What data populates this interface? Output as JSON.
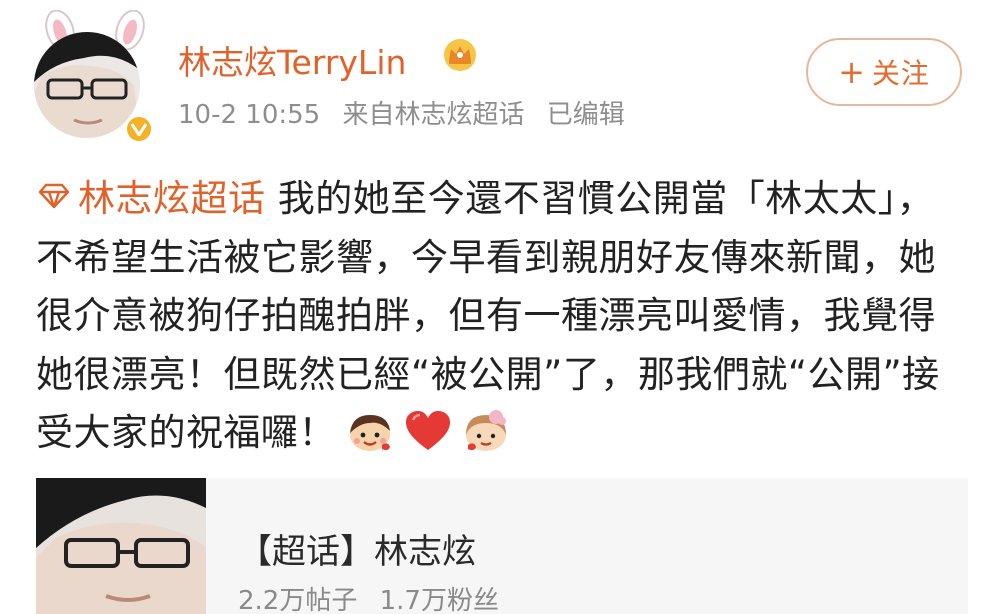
{
  "post": {
    "author": {
      "name": "林志炫TerryLin",
      "avatar_icon": "avatar-photo",
      "verified_icon": "verified-badge-icon",
      "vip_icon": "crown-icon"
    },
    "meta": {
      "time": "10-2 10:55",
      "source": "来自林志炫超话",
      "edited": "已编辑"
    },
    "follow_button": {
      "icon": "+",
      "label": "关注"
    },
    "content": {
      "topic": "林志炫超话",
      "body": " 我的她至今還不習慣公開當「林太太」，不希望生活被它影響，今早看到親朋好友傳來新聞，她很介意被狗仔拍醜拍胖，但有一種漂亮叫愛情，我覺得她很漂亮！但既然已經“被公開”了，那我們就“公開”接受大家的祝福囉！",
      "emojis": [
        "boy-smile-emoji",
        "red-heart-emoji",
        "girl-emoji"
      ]
    }
  },
  "topic_card": {
    "title": "【超话】林志炫",
    "posts": "2.2万帖子",
    "fans": "1.7万粉丝"
  },
  "colors": {
    "accent": "#e0622a",
    "meta_gray": "#8e8e8e",
    "verified": "#f4b227",
    "follow_border": "#e8b79b"
  }
}
